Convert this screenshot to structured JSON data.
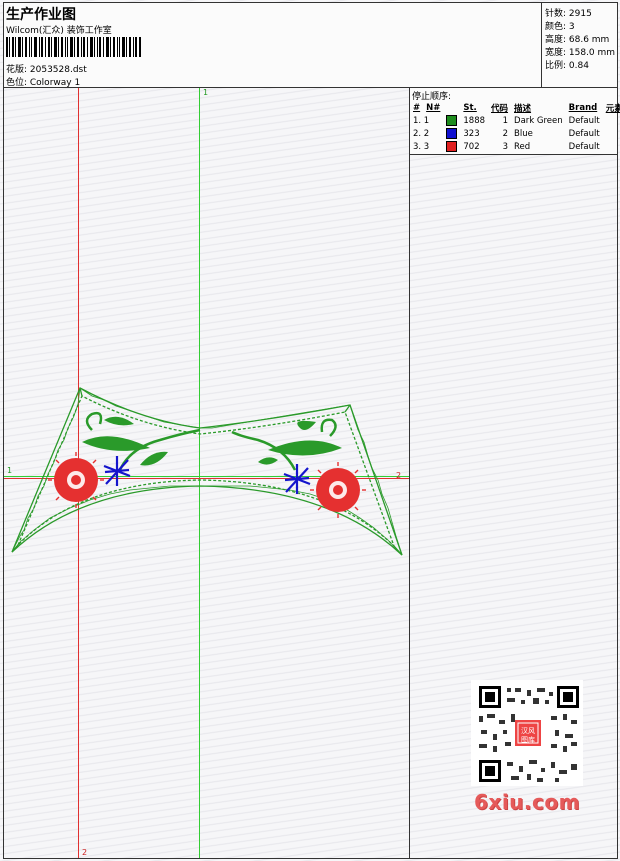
{
  "header": {
    "title": "生产作业图",
    "studio": "Wilcom(汇众) 装饰工作室",
    "file": "花版: 2053528.dst",
    "colorway": "色位: Colorway 1"
  },
  "stats": {
    "stitches": "针数: 2915",
    "colors": "颜色: 3",
    "height": "高度: 68.6 mm",
    "width": "宽度: 158.0 mm",
    "scale": "比例: 0.84"
  },
  "legend": {
    "title": "停止顺序:",
    "headers": [
      "#",
      "N#",
      "St.",
      "代码",
      "描述",
      "Brand",
      "元素"
    ],
    "rows": [
      {
        "idx": "1. 1",
        "color": "#1e8c1e",
        "stitches": "1888",
        "code": "1",
        "desc": "Dark Green",
        "brand": "Default"
      },
      {
        "idx": "2. 2",
        "color": "#1010d0",
        "stitches": "323",
        "code": "2",
        "desc": "Blue",
        "brand": "Default"
      },
      {
        "idx": "3. 3",
        "color": "#e02020",
        "stitches": "702",
        "code": "3",
        "desc": "Red",
        "brand": "Default"
      }
    ]
  },
  "axes": {
    "top": "1",
    "bottom": "2",
    "left": "1",
    "right": "2"
  },
  "watermark": {
    "text": "6xiu.com",
    "stamp": "汉风图库"
  },
  "colors": {
    "green_guide": "#33cc33",
    "red_guide": "#e03030"
  }
}
